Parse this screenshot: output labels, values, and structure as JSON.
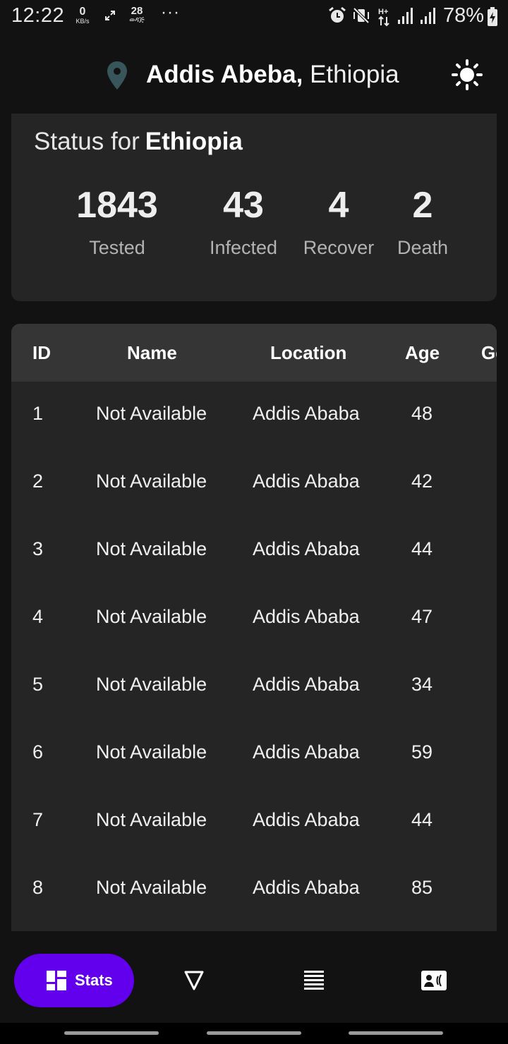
{
  "status_bar": {
    "time": "12:22",
    "net_speed_value": "0",
    "net_speed_unit": "KB/s",
    "notification_number": "28",
    "more": "···",
    "battery_percent": "78%"
  },
  "header": {
    "city": "Addis Abeba,",
    "country": "Ethiopia"
  },
  "status": {
    "prefix": "Status for",
    "country": "Ethiopia",
    "stats": [
      {
        "value": "1843",
        "label": "Tested"
      },
      {
        "value": "43",
        "label": "Infected"
      },
      {
        "value": "4",
        "label": "Recover"
      },
      {
        "value": "2",
        "label": "Death"
      }
    ]
  },
  "table": {
    "columns": [
      "ID",
      "Name",
      "Location",
      "Age",
      "Ge"
    ],
    "rows": [
      {
        "id": "1",
        "name": "Not Available",
        "location": "Addis Ababa",
        "age": "48"
      },
      {
        "id": "2",
        "name": "Not Available",
        "location": "Addis Ababa",
        "age": "42"
      },
      {
        "id": "3",
        "name": "Not Available",
        "location": "Addis Ababa",
        "age": "44"
      },
      {
        "id": "4",
        "name": "Not Available",
        "location": "Addis Ababa",
        "age": "47"
      },
      {
        "id": "5",
        "name": "Not Available",
        "location": "Addis Ababa",
        "age": "34"
      },
      {
        "id": "6",
        "name": "Not Available",
        "location": "Addis Ababa",
        "age": "59"
      },
      {
        "id": "7",
        "name": "Not Available",
        "location": "Addis Ababa",
        "age": "44"
      },
      {
        "id": "8",
        "name": "Not Available",
        "location": "Addis Ababa",
        "age": "85"
      }
    ]
  },
  "bottom_nav": {
    "stats_label": "Stats",
    "icons": [
      "dashboard-icon",
      "filter-triangle-icon",
      "list-icon",
      "contact-card-icon"
    ]
  },
  "colors": {
    "accent": "#6200ee",
    "background": "#121212",
    "card": "#252525",
    "table_header": "#353535",
    "pin": "#37555a"
  }
}
